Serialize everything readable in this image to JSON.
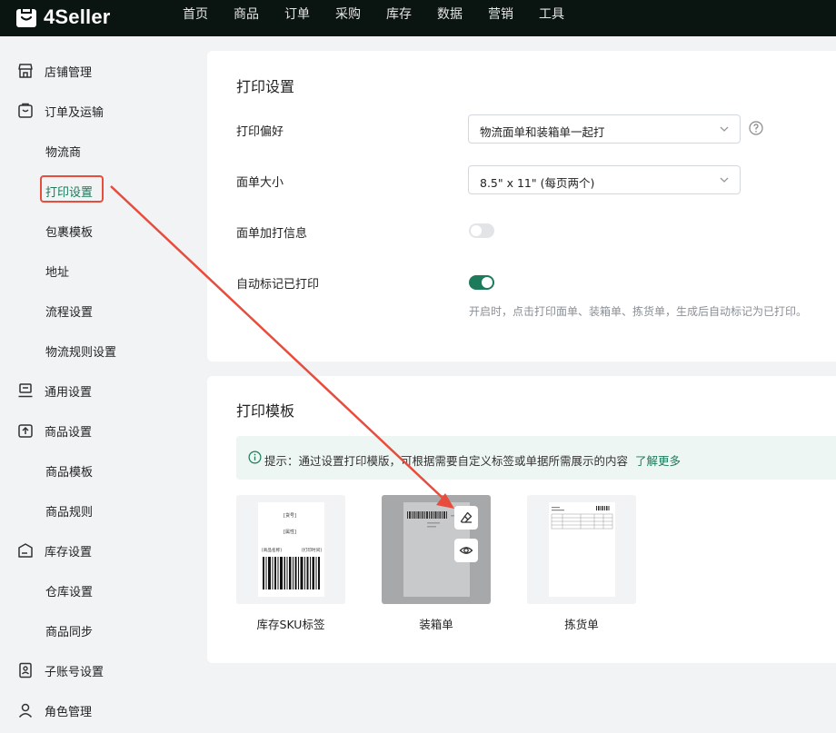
{
  "app": {
    "logo_text": "4Seller"
  },
  "nav": [
    "首页",
    "商品",
    "订单",
    "采购",
    "库存",
    "数据",
    "营销",
    "工具"
  ],
  "sidebar": {
    "items": [
      {
        "label": "店铺管理"
      },
      {
        "label": "订单及运输"
      },
      {
        "label": "物流商"
      },
      {
        "label": "打印设置"
      },
      {
        "label": "包裹模板"
      },
      {
        "label": "地址"
      },
      {
        "label": "流程设置"
      },
      {
        "label": "物流规则设置"
      },
      {
        "label": "通用设置"
      },
      {
        "label": "商品设置"
      },
      {
        "label": "商品模板"
      },
      {
        "label": "商品规则"
      },
      {
        "label": "库存设置"
      },
      {
        "label": "仓库设置"
      },
      {
        "label": "商品同步"
      },
      {
        "label": "子账号设置"
      },
      {
        "label": "角色管理"
      }
    ]
  },
  "print_settings": {
    "title": "打印设置",
    "preference_label": "打印偏好",
    "preference_value": "物流面单和装箱单一起打",
    "size_label": "面单大小",
    "size_value": "8.5\" x 11\" (每页两个)",
    "extra_info_label": "面单加打信息",
    "extra_info_enabled": false,
    "auto_mark_label": "自动标记已打印",
    "auto_mark_enabled": true,
    "auto_mark_hint": "开启时，点击打印面单、装箱单、拣货单，生成后自动标记为已打印。"
  },
  "print_templates": {
    "title": "打印模板",
    "tip_text": "提示：通过设置打印模版，可根据需要自定义标签或单据所需展示的内容",
    "tip_link": "了解更多",
    "templates": [
      {
        "name": "库存SKU标签",
        "preview_lines": [
          "[货号]",
          "[属性]",
          "[商品名称]",
          "[打印时间]"
        ]
      },
      {
        "name": "装箱单"
      },
      {
        "name": "拣货单"
      }
    ]
  },
  "colors": {
    "accent": "#1d7a5a",
    "topbar": "#0a1410",
    "highlight": "#e74c3c"
  }
}
